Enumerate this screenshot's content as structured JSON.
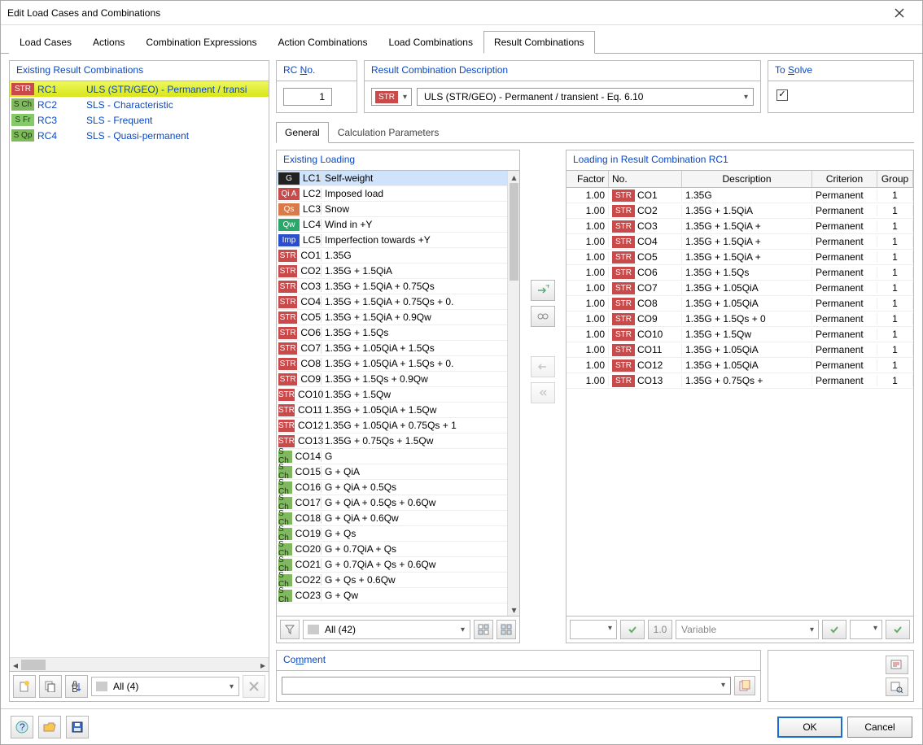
{
  "window": {
    "title": "Edit Load Cases and Combinations"
  },
  "main_tabs": [
    "Load Cases",
    "Actions",
    "Combination Expressions",
    "Action Combinations",
    "Load Combinations",
    "Result Combinations"
  ],
  "main_tab_active": 5,
  "left_panel": {
    "title": "Existing Result Combinations",
    "items": [
      {
        "badge": "STR",
        "badge_cls": "str",
        "id": "RC1",
        "desc": "ULS (STR/GEO) - Permanent / transi",
        "selected": true
      },
      {
        "badge": "S Ch",
        "badge_cls": "sch",
        "id": "RC2",
        "desc": "SLS - Characteristic"
      },
      {
        "badge": "S Fr",
        "badge_cls": "sfr",
        "id": "RC3",
        "desc": "SLS - Frequent"
      },
      {
        "badge": "S Qp",
        "badge_cls": "sqp",
        "id": "RC4",
        "desc": "SLS - Quasi-permanent"
      }
    ],
    "filter_label": "All (4)"
  },
  "rc_no": {
    "title": "RC No.",
    "value": "1"
  },
  "rc_desc": {
    "title": "Result Combination Description",
    "badge": "STR",
    "text": "ULS (STR/GEO) - Permanent / transient - Eq. 6.10"
  },
  "solve": {
    "title": "To Solve",
    "checked": true
  },
  "sub_tabs": [
    "General",
    "Calculation Parameters"
  ],
  "sub_tab_active": 0,
  "existing_loading": {
    "title": "Existing Loading",
    "filter_label": "All (42)",
    "rows": [
      {
        "badge": "G",
        "cls": "g",
        "id": "LC1",
        "txt": "Self-weight",
        "sel": true
      },
      {
        "badge": "Qi A",
        "cls": "qia",
        "id": "LC2",
        "txt": "Imposed load"
      },
      {
        "badge": "Qs",
        "cls": "qs",
        "id": "LC3",
        "txt": "Snow"
      },
      {
        "badge": "Qw",
        "cls": "qw",
        "id": "LC4",
        "txt": "Wind in +Y"
      },
      {
        "badge": "Imp",
        "cls": "imp",
        "id": "LC5",
        "txt": "Imperfection towards +Y"
      },
      {
        "badge": "STR",
        "cls": "str",
        "id": "CO1",
        "txt": "1.35G"
      },
      {
        "badge": "STR",
        "cls": "str",
        "id": "CO2",
        "txt": "1.35G + 1.5QiA"
      },
      {
        "badge": "STR",
        "cls": "str",
        "id": "CO3",
        "txt": "1.35G + 1.5QiA + 0.75Qs"
      },
      {
        "badge": "STR",
        "cls": "str",
        "id": "CO4",
        "txt": "1.35G + 1.5QiA + 0.75Qs + 0."
      },
      {
        "badge": "STR",
        "cls": "str",
        "id": "CO5",
        "txt": "1.35G + 1.5QiA + 0.9Qw"
      },
      {
        "badge": "STR",
        "cls": "str",
        "id": "CO6",
        "txt": "1.35G + 1.5Qs"
      },
      {
        "badge": "STR",
        "cls": "str",
        "id": "CO7",
        "txt": "1.35G + 1.05QiA + 1.5Qs"
      },
      {
        "badge": "STR",
        "cls": "str",
        "id": "CO8",
        "txt": "1.35G + 1.05QiA + 1.5Qs + 0."
      },
      {
        "badge": "STR",
        "cls": "str",
        "id": "CO9",
        "txt": "1.35G + 1.5Qs + 0.9Qw"
      },
      {
        "badge": "STR",
        "cls": "str",
        "id": "CO10",
        "txt": "1.35G + 1.5Qw"
      },
      {
        "badge": "STR",
        "cls": "str",
        "id": "CO11",
        "txt": "1.35G + 1.05QiA + 1.5Qw"
      },
      {
        "badge": "STR",
        "cls": "str",
        "id": "CO12",
        "txt": "1.35G + 1.05QiA + 0.75Qs + 1"
      },
      {
        "badge": "STR",
        "cls": "str",
        "id": "CO13",
        "txt": "1.35G + 0.75Qs + 1.5Qw"
      },
      {
        "badge": "S Ch",
        "cls": "sch",
        "id": "CO14",
        "txt": "G"
      },
      {
        "badge": "S Ch",
        "cls": "sch",
        "id": "CO15",
        "txt": "G + QiA"
      },
      {
        "badge": "S Ch",
        "cls": "sch",
        "id": "CO16",
        "txt": "G + QiA + 0.5Qs"
      },
      {
        "badge": "S Ch",
        "cls": "sch",
        "id": "CO17",
        "txt": "G + QiA + 0.5Qs + 0.6Qw"
      },
      {
        "badge": "S Ch",
        "cls": "sch",
        "id": "CO18",
        "txt": "G + QiA + 0.6Qw"
      },
      {
        "badge": "S Ch",
        "cls": "sch",
        "id": "CO19",
        "txt": "G + Qs"
      },
      {
        "badge": "S Ch",
        "cls": "sch",
        "id": "CO20",
        "txt": "G + 0.7QiA + Qs"
      },
      {
        "badge": "S Ch",
        "cls": "sch",
        "id": "CO21",
        "txt": "G + 0.7QiA + Qs + 0.6Qw"
      },
      {
        "badge": "S Ch",
        "cls": "sch",
        "id": "CO22",
        "txt": "G + Qs + 0.6Qw"
      },
      {
        "badge": "S Ch",
        "cls": "sch",
        "id": "CO23",
        "txt": "G + Qw"
      }
    ]
  },
  "rc_loading": {
    "title": "Loading in Result Combination RC1",
    "headers": [
      "Factor",
      "No.",
      "Description",
      "Criterion",
      "Group"
    ],
    "rows": [
      {
        "f": "1.00",
        "no": "CO1",
        "d": "1.35G",
        "cr": "Permanent",
        "g": "1"
      },
      {
        "f": "1.00",
        "no": "CO2",
        "d": "1.35G + 1.5QiA",
        "cr": "Permanent",
        "g": "1"
      },
      {
        "f": "1.00",
        "no": "CO3",
        "d": "1.35G + 1.5QiA +",
        "cr": "Permanent",
        "g": "1"
      },
      {
        "f": "1.00",
        "no": "CO4",
        "d": "1.35G + 1.5QiA +",
        "cr": "Permanent",
        "g": "1"
      },
      {
        "f": "1.00",
        "no": "CO5",
        "d": "1.35G + 1.5QiA +",
        "cr": "Permanent",
        "g": "1"
      },
      {
        "f": "1.00",
        "no": "CO6",
        "d": "1.35G + 1.5Qs",
        "cr": "Permanent",
        "g": "1"
      },
      {
        "f": "1.00",
        "no": "CO7",
        "d": "1.35G + 1.05QiA",
        "cr": "Permanent",
        "g": "1"
      },
      {
        "f": "1.00",
        "no": "CO8",
        "d": "1.35G + 1.05QiA",
        "cr": "Permanent",
        "g": "1"
      },
      {
        "f": "1.00",
        "no": "CO9",
        "d": "1.35G + 1.5Qs + 0",
        "cr": "Permanent",
        "g": "1"
      },
      {
        "f": "1.00",
        "no": "CO10",
        "d": "1.35G + 1.5Qw",
        "cr": "Permanent",
        "g": "1"
      },
      {
        "f": "1.00",
        "no": "CO11",
        "d": "1.35G + 1.05QiA",
        "cr": "Permanent",
        "g": "1"
      },
      {
        "f": "1.00",
        "no": "CO12",
        "d": "1.35G + 1.05QiA",
        "cr": "Permanent",
        "g": "1"
      },
      {
        "f": "1.00",
        "no": "CO13",
        "d": "1.35G + 0.75Qs +",
        "cr": "Permanent",
        "g": "1"
      }
    ],
    "foot": {
      "factor_placeholder": "1.0",
      "variable_placeholder": "Variable"
    }
  },
  "comment": {
    "title": "Comment"
  },
  "bottom": {
    "ok": "OK",
    "cancel": "Cancel"
  }
}
